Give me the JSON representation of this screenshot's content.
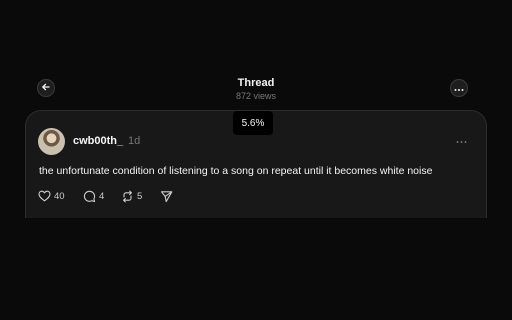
{
  "header": {
    "title": "Thread",
    "views": "872 views"
  },
  "tooltip": {
    "value": "5.6%"
  },
  "post": {
    "username": "cwb00th_",
    "timestamp": "1d",
    "text": "the unfortunate condition of listening to a song on repeat until it becomes white noise",
    "likes": "40",
    "replies": "4",
    "reposts": "5"
  },
  "icons": {
    "back": "arrow-left-icon",
    "more": "more-horizontal-icon",
    "like": "heart-icon",
    "reply": "comment-icon",
    "repost": "repost-icon",
    "share": "send-icon"
  },
  "colors": {
    "background": "#0a0a0a",
    "card": "#181818",
    "text": "#f3f5f7",
    "muted": "#777777"
  }
}
